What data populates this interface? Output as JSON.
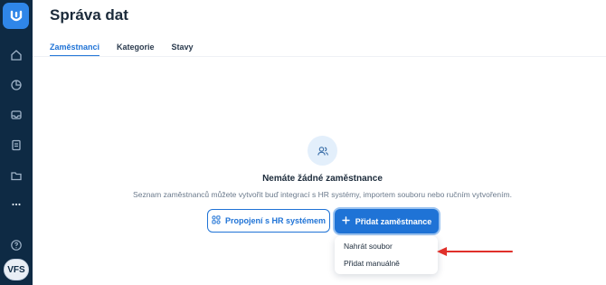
{
  "sidebar": {
    "logo_icon": "logo-icon",
    "items": [
      {
        "icon": "home-icon"
      },
      {
        "icon": "chart-icon"
      },
      {
        "icon": "inbox-icon"
      },
      {
        "icon": "clipboard-icon"
      },
      {
        "icon": "folder-icon"
      },
      {
        "icon": "more-icon"
      }
    ],
    "help_icon": "help-icon",
    "avatar_text": "VFS"
  },
  "header": {
    "title": "Správa dat"
  },
  "tabs": [
    {
      "label": "Zaměstnanci",
      "active": true
    },
    {
      "label": "Kategorie",
      "active": false
    },
    {
      "label": "Stavy",
      "active": false
    }
  ],
  "empty_state": {
    "icon": "users-icon",
    "title": "Nemáte žádné zaměstnance",
    "description": "Seznam zaměstnanců můžete vytvořit buď integrací s HR systémy, importem souboru nebo ručním vytvořením."
  },
  "actions": {
    "hr_button_label": "Propojení s HR systémem",
    "add_button_label": "Přidat zaměstnance"
  },
  "dropdown": {
    "items": [
      "Nahrát soubor",
      "Přidat manuálně"
    ]
  },
  "colors": {
    "sidebar": "#0e2a44",
    "accent": "#1f73d6",
    "annotation_arrow": "#e0302a"
  }
}
